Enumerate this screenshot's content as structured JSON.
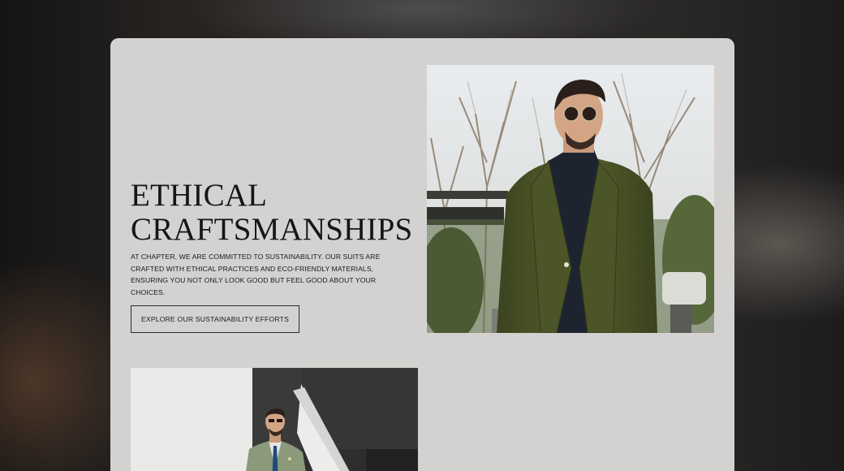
{
  "section": {
    "heading_line1": "ETHICAL",
    "heading_line2": "CRAFTSMANSHIPS",
    "body": "AT CHAPTER, WE ARE COMMITTED TO SUSTAINABILITY. OUR SUITS ARE CRAFTED WITH ETHICAL PRACTICES AND ECO-FRIENDLY MATERIALS, ENSURING YOU NOT ONLY LOOK GOOD BUT FEEL GOOD ABOUT YOUR CHOICES.",
    "cta_label": "EXPLORE OUR SUSTAINABILITY EFFORTS"
  },
  "images": {
    "hero": "man-in-olive-blazer-photo",
    "secondary": "man-in-sage-suit-on-stairs-photo"
  },
  "colors": {
    "card_background": "#d3d2d0",
    "text": "#151515",
    "blazer_olive": "#4a5226",
    "suit_sage": "#8a9a7a"
  }
}
